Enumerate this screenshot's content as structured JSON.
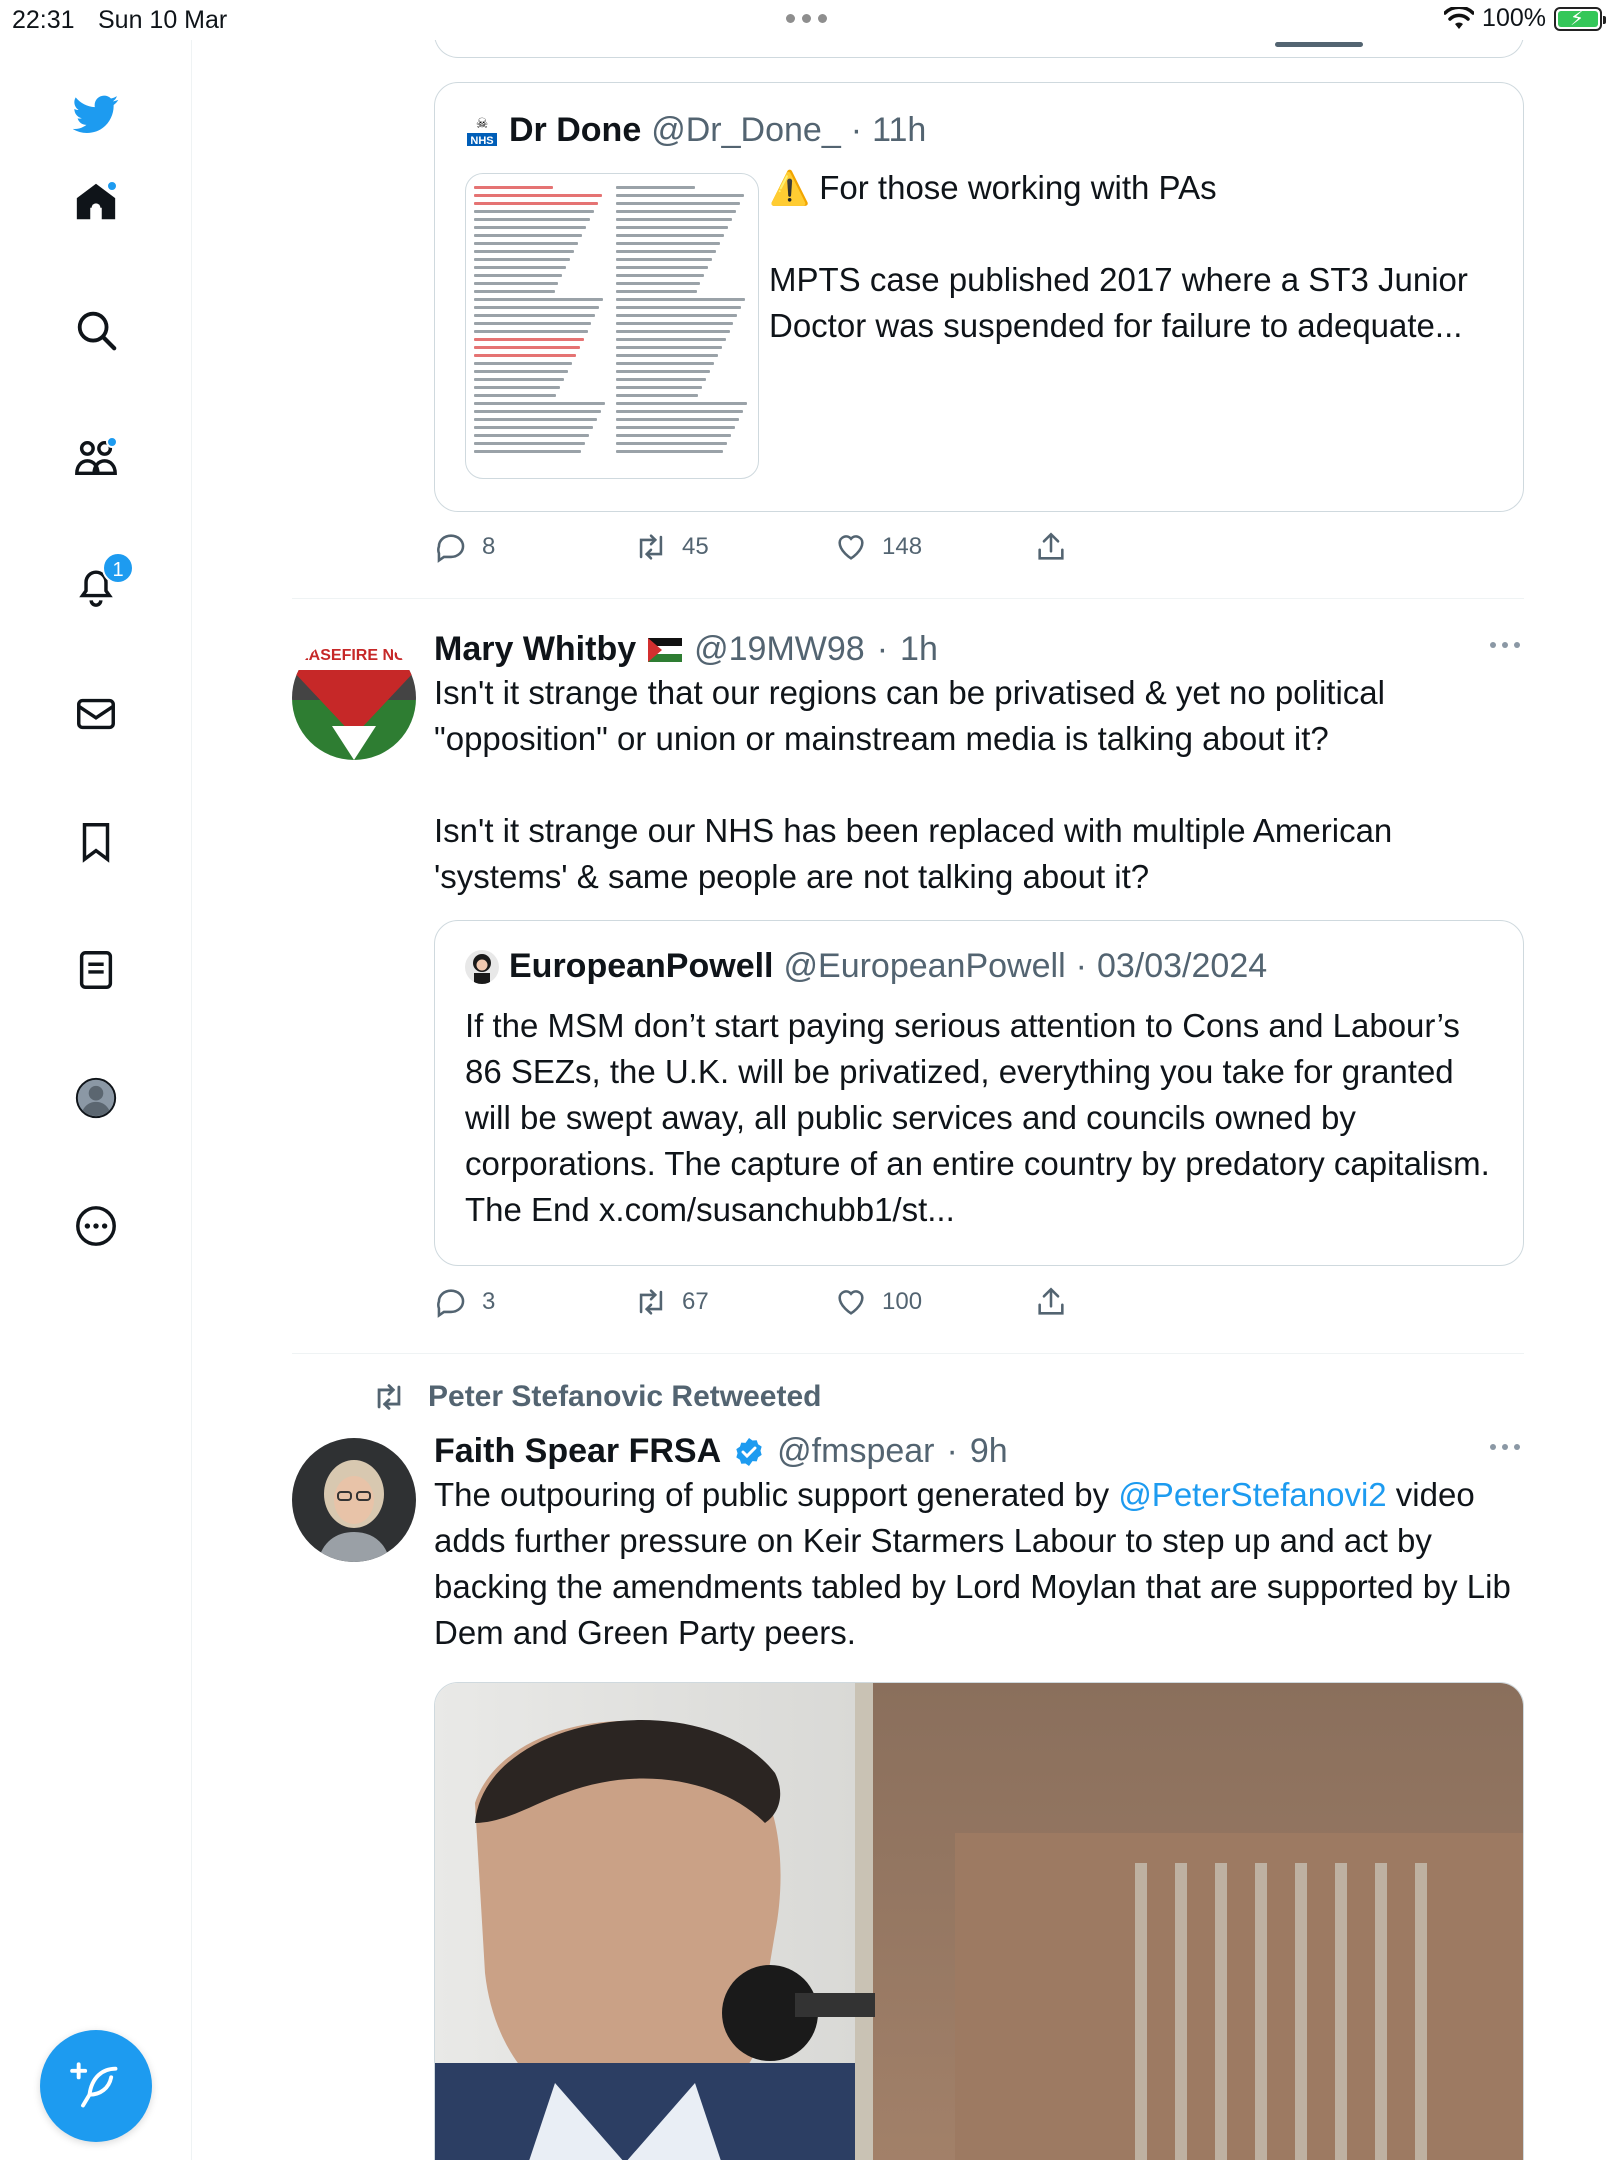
{
  "status_bar": {
    "time": "22:31",
    "date": "Sun 10 Mar",
    "battery": "100%"
  },
  "sidebar": {
    "notifications_badge": "1",
    "items": [
      "home",
      "explore",
      "communities",
      "notifications",
      "messages",
      "bookmarks",
      "lists",
      "profile",
      "more"
    ]
  },
  "tweets": [
    {
      "quote": {
        "name": "Dr Done",
        "handle": "@Dr_Done_",
        "time": "11h",
        "text_line1": "⚠️ For those working with PAs",
        "text_line2": "MPTS case published 2017 where a ST3 Junior Doctor was suspended for failure to adequate..."
      },
      "replies": "8",
      "retweets": "45",
      "likes": "148"
    },
    {
      "name": "Mary Whitby",
      "handle": "@19MW98",
      "time": "1h",
      "text": "Isn't it strange that our regions can be privatised & yet no political \"opposition\" or union or mainstream media is talking about it?\n\nIsn't it strange our NHS has been replaced with multiple American 'systems' & same people are not talking about it?",
      "quote": {
        "name": "EuropeanPowell",
        "handle": "@EuropeanPowell",
        "time": "03/03/2024",
        "text": "If the MSM don’t start paying serious attention to Cons and Labour’s 86 SEZs, the U.K. will be privatized, everything you take for granted will be swept away, all public services and councils owned by corporations. The capture of an entire country by predatory capitalism. The End x.com/susanchubb1/st..."
      },
      "replies": "3",
      "retweets": "67",
      "likes": "100"
    },
    {
      "retweeted_by": "Peter Stefanovic Retweeted",
      "name": "Faith Spear FRSA",
      "handle": "@fmspear",
      "time": "9h",
      "text_pre": "The outpouring of public support generated by ",
      "mention": "@PeterStefanovi2",
      "text_post": " video adds further pressure on Keir Starmers Labour to step up and act by backing the amendments tabled by Lord Moylan that are supported by Lib Dem and Green Party peers."
    }
  ],
  "colors": {
    "accent": "#1d9bf0",
    "secondary_text": "#536471",
    "border": "#cfd9de"
  }
}
